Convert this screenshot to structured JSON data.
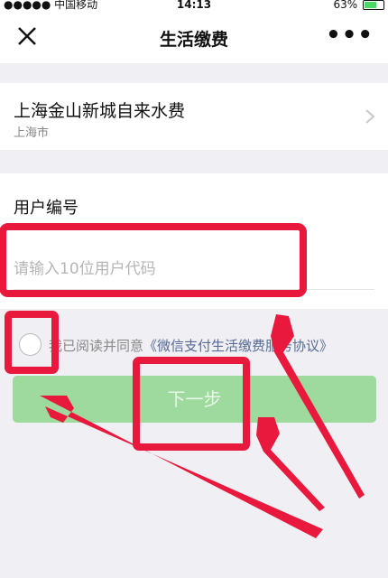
{
  "status_bar": {
    "carrier": "●●●●● 中国移动",
    "time": "14:13",
    "battery": "63%",
    "battery_level": 0.63
  },
  "nav": {
    "title": "生活缴费",
    "more": "•••",
    "close_icon": "close-icon"
  },
  "biller": {
    "name": "上海金山新城自来水费",
    "city": "上海市"
  },
  "form": {
    "label": "用户编号",
    "placeholder": "请输入10位用户代码",
    "value": ""
  },
  "agreement": {
    "prefix": "我已阅读并同意",
    "link": "《微信支付生活缴费服务协议》",
    "checked": false
  },
  "next_button": {
    "label": "下一步"
  },
  "annotation_color": "#e8193c"
}
